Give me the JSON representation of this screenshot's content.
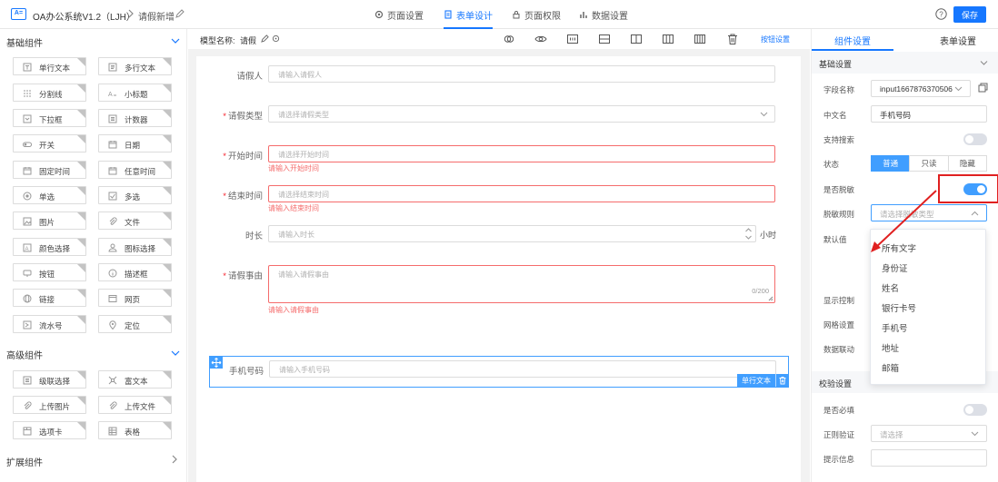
{
  "app": {
    "title": "OA办公系统V1.2（LJH）",
    "breadcrumb": "请假新增"
  },
  "top_tabs": [
    {
      "label": "页面设置",
      "icon": "gear-icon"
    },
    {
      "label": "表单设计",
      "icon": "document-icon",
      "active": true
    },
    {
      "label": "页面权限",
      "icon": "lock-icon"
    },
    {
      "label": "数据设置",
      "icon": "bar-chart-icon"
    }
  ],
  "toolbar": {
    "save_label": "保存"
  },
  "left": {
    "basic_title": "基础组件",
    "basic": [
      "单行文本",
      "多行文本",
      "分割线",
      "小标题",
      "下拉框",
      "计数器",
      "开关",
      "日期",
      "固定时间",
      "任意时间",
      "单选",
      "多选",
      "图片",
      "文件",
      "颜色选择",
      "图标选择",
      "按钮",
      "描述框",
      "链接",
      "网页",
      "流水号",
      "定位"
    ],
    "advanced_title": "高级组件",
    "advanced": [
      "级联选择",
      "富文本",
      "上传图片",
      "上传文件",
      "选项卡",
      "表格"
    ],
    "extend_title": "扩展组件"
  },
  "canvas": {
    "model_label": "模型名称:",
    "model_value": "请假",
    "btn_settings": "按钮设置",
    "fields": [
      {
        "label": "请假人",
        "placeholder": "请输入请假人",
        "required": false
      },
      {
        "label": "请假类型",
        "placeholder": "请选择请假类型",
        "required": true
      },
      {
        "label": "开始时间",
        "placeholder": "请选择开始时间",
        "required": true,
        "error": "请输入开始时间"
      },
      {
        "label": "结束时间",
        "placeholder": "请选择结束时间",
        "required": true,
        "error": "请输入结束时间"
      },
      {
        "label": "时长",
        "placeholder": "请输入时长",
        "required": false,
        "suffix": "小时"
      },
      {
        "label": "请假事由",
        "placeholder": "请输入请假事由",
        "required": true,
        "error": "请输入请假事由",
        "counter": "0/200"
      },
      {
        "label": "手机号码",
        "placeholder": "请输入手机号码",
        "required": false
      }
    ],
    "selected_tag": "单行文本"
  },
  "right": {
    "tabs": [
      "组件设置",
      "表单设置"
    ],
    "basic_section": "基础设置",
    "field_name_label": "字段名称",
    "field_name_value": "input1667876370506",
    "cn_name_label": "中文名",
    "cn_name_value": "手机号码",
    "search_label": "支持搜索",
    "search_on": false,
    "status_label": "状态",
    "status_options": [
      "普通",
      "只读",
      "隐藏"
    ],
    "status_selected": "普通",
    "mask_label": "是否脱敏",
    "mask_on": true,
    "mask_rule_label": "脱敏规则",
    "mask_rule_placeholder": "请选择脱敏类型",
    "default_label": "默认值",
    "display_ctrl_label": "显示控制",
    "grid_label": "网格设置",
    "data_link_label": "数据联动",
    "validate_section": "校验设置",
    "required_label": "是否必填",
    "required_on": false,
    "regex_label": "正则验证",
    "regex_placeholder": "请选择",
    "hint_label": "提示信息",
    "dropdown": [
      "所有文字",
      "身份证",
      "姓名",
      "银行卡号",
      "手机号",
      "地址",
      "邮箱"
    ]
  },
  "colors": {
    "accent": "#1677ff",
    "error": "#f56c6c",
    "highlight": "#e02020"
  }
}
